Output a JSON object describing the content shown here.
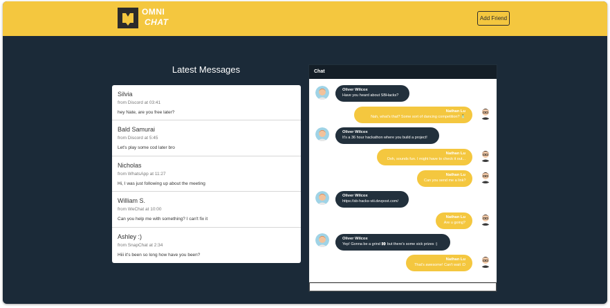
{
  "header": {
    "brand_line1": "OMNI",
    "brand_line2": "CHAT",
    "add_friend_label": "Add Friend",
    "accent": "#f4c73f"
  },
  "latest": {
    "title": "Latest Messages",
    "items": [
      {
        "name": "Silvia",
        "meta": "from Discord at 03:41",
        "text": "hey Nate, are you free later?"
      },
      {
        "name": "Bald Samurai",
        "meta": "from Discord at 5:45",
        "text": "Let's play some cod later bro"
      },
      {
        "name": "Nicholas",
        "meta": "from WhatsApp at 11:27",
        "text": "Hi, I was just following up about the meeting"
      },
      {
        "name": "William S.",
        "meta": "from WeChat at 10:00",
        "text": "Can you help me with something? I can't fix it"
      },
      {
        "name": "Ashley :)",
        "meta": "from SnapChat at 2:34",
        "text": "Hiii it's been so long how have you been?"
      }
    ]
  },
  "chat": {
    "title": "Chat",
    "messages": [
      {
        "side": "in",
        "name": "Oliver Wilcox",
        "text": "Have you heard about SBHacks?"
      },
      {
        "side": "out",
        "name": "Nathan Lu",
        "text": "Nah, what's that? Some sort of dancing competition? 🕺"
      },
      {
        "side": "in",
        "name": "Oliver Wilcox",
        "text": "It's a 36 hour hackathon where you build a project!"
      },
      {
        "side": "out",
        "name": "Nathan Lu",
        "text": "Ooh, sounds fun. I might have to check it out..."
      },
      {
        "side": "out",
        "name": "Nathan Lu",
        "text": "Can you send me a link?"
      },
      {
        "side": "in",
        "name": "Oliver Wilcox",
        "text": "https://sb-hacks-viii.devpost.com/"
      },
      {
        "side": "out",
        "name": "Nathan Lu",
        "text": "Are u going?"
      },
      {
        "side": "in",
        "name": "Oliver Wilcox",
        "text": "Yep! Gonna be a grind 👀 but there's some sick prizes :)"
      },
      {
        "side": "out",
        "name": "Nathan Lu",
        "text": "That's awesome! Can't wait :D"
      }
    ],
    "input_value": ""
  }
}
